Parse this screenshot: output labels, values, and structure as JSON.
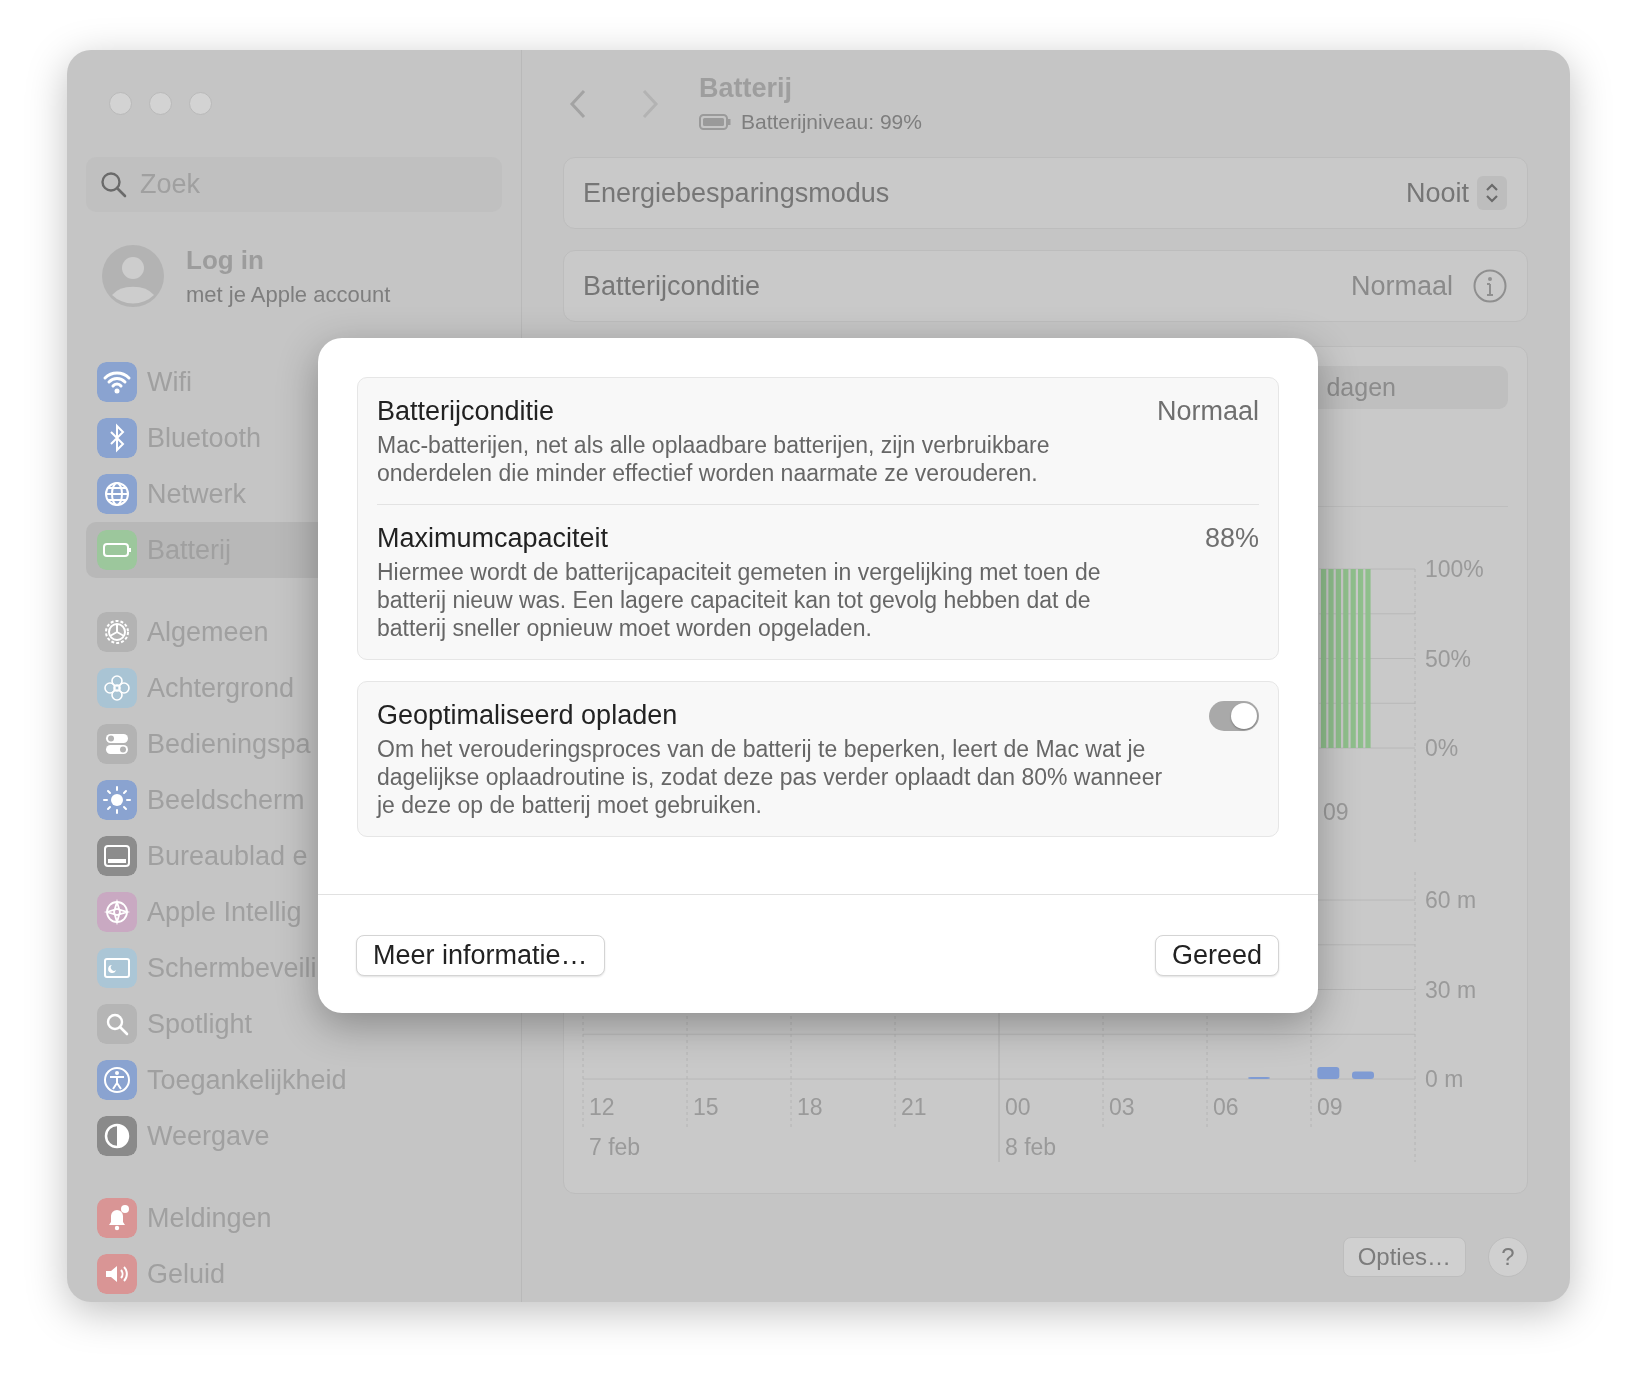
{
  "window": {
    "title": "Batterij",
    "subtitle": "Batterijniveau: 99%"
  },
  "sidebar": {
    "search": {
      "placeholder": "Zoek"
    },
    "account": {
      "title": "Log in",
      "subtitle": "met je Apple account"
    },
    "groups": [
      {
        "items": [
          {
            "label": "Wifi",
            "selected": false,
            "color": "#8aa3d0"
          },
          {
            "label": "Bluetooth",
            "selected": false,
            "color": "#8aa3d0"
          },
          {
            "label": "Netwerk",
            "selected": false,
            "color": "#8aa3d0"
          },
          {
            "label": "Batterij",
            "selected": true,
            "color": "#9cc79c"
          }
        ]
      },
      {
        "items": [
          {
            "label": "Algemeen",
            "selected": false,
            "color": "#b3b3b3"
          },
          {
            "label": "Achtergrond",
            "selected": false,
            "color": "#a9c4d4"
          },
          {
            "label": "Bedieningspa",
            "selected": false,
            "color": "#b3b3b3"
          },
          {
            "label": "Beeldscherm",
            "selected": false,
            "color": "#8aa3d0"
          },
          {
            "label": "Bureaublad e",
            "selected": false,
            "color": "#8c8c8c"
          },
          {
            "label": "Apple Intellig",
            "selected": false,
            "color": "#c9a9c2"
          },
          {
            "label": "Schermbeveili",
            "selected": false,
            "color": "#abc6d6"
          },
          {
            "label": "Spotlight",
            "selected": false,
            "color": "#b5b5b5"
          },
          {
            "label": "Toegankelijkheid",
            "selected": false,
            "color": "#8aa3d0"
          },
          {
            "label": "Weergave",
            "selected": false,
            "color": "#8a8a8a"
          }
        ]
      },
      {
        "items": [
          {
            "label": "Meldingen",
            "selected": false,
            "color": "#d99595"
          },
          {
            "label": "Geluid",
            "selected": false,
            "color": "#d99595"
          }
        ]
      }
    ]
  },
  "settings": [
    {
      "kind": "popup",
      "label": "Energiebesparingsmodus",
      "value": "Nooit"
    },
    {
      "kind": "info",
      "label": "Batterijconditie",
      "value": "Normaal"
    }
  ],
  "usage": {
    "segment": "dagen",
    "level_chart": {
      "axis_labels": [
        "100%",
        "50%",
        "0%"
      ],
      "time_label": "09"
    },
    "screen_chart": {
      "chart_data": {
        "type": "bar",
        "categories": [
          "12",
          null,
          null,
          "15",
          null,
          null,
          "18",
          null,
          null,
          "21",
          null,
          null,
          "00",
          null,
          null,
          "03",
          null,
          null,
          "06",
          null,
          null,
          "09",
          null,
          null
        ],
        "values": [
          0,
          0,
          0,
          0,
          0,
          0,
          0,
          0,
          0,
          0,
          0,
          0,
          0,
          0,
          0,
          0,
          0,
          0,
          0,
          0.5,
          0,
          4,
          2.5,
          0
        ],
        "ylim": [
          0,
          60
        ],
        "yticks": [
          {
            "value": 0,
            "label": "0 m"
          },
          {
            "value": 30,
            "label": "30 m"
          },
          {
            "value": 60,
            "label": "60 m"
          }
        ],
        "annotations": [
          "7 feb",
          "8 feb"
        ]
      }
    }
  },
  "footer": {
    "buttons": [
      "Opties…",
      "?"
    ]
  },
  "sheet": {
    "sections": [
      {
        "rows": [
          {
            "kind": "value",
            "title": "Batterijconditie",
            "value": "Normaal",
            "description": "Mac-batterijen, net als alle oplaadbare batterijen, zijn verbruikbare onderdelen die minder effectief worden naarmate ze verouderen."
          },
          {
            "kind": "value",
            "title": "Maximumcapaciteit",
            "value": "88%",
            "description": "Hiermee wordt de batterijcapaciteit gemeten in vergelijking met toen de batterij nieuw was. Een lagere capaciteit kan tot gevolg hebben dat de batterij sneller opnieuw moet worden opgeladen."
          }
        ]
      },
      {
        "rows": [
          {
            "kind": "toggle",
            "title": "Geoptimaliseerd opladen",
            "on": true,
            "disabled": true,
            "description": "Om het verouderingsproces van de batterij te beperken, leert de Mac wat je dagelijkse oplaadroutine is, zodat deze pas verder oplaadt dan 80% wanneer je deze op de batterij moet gebruiken."
          }
        ]
      }
    ],
    "buttons": [
      "Meer informatie…",
      "Gereed"
    ]
  }
}
